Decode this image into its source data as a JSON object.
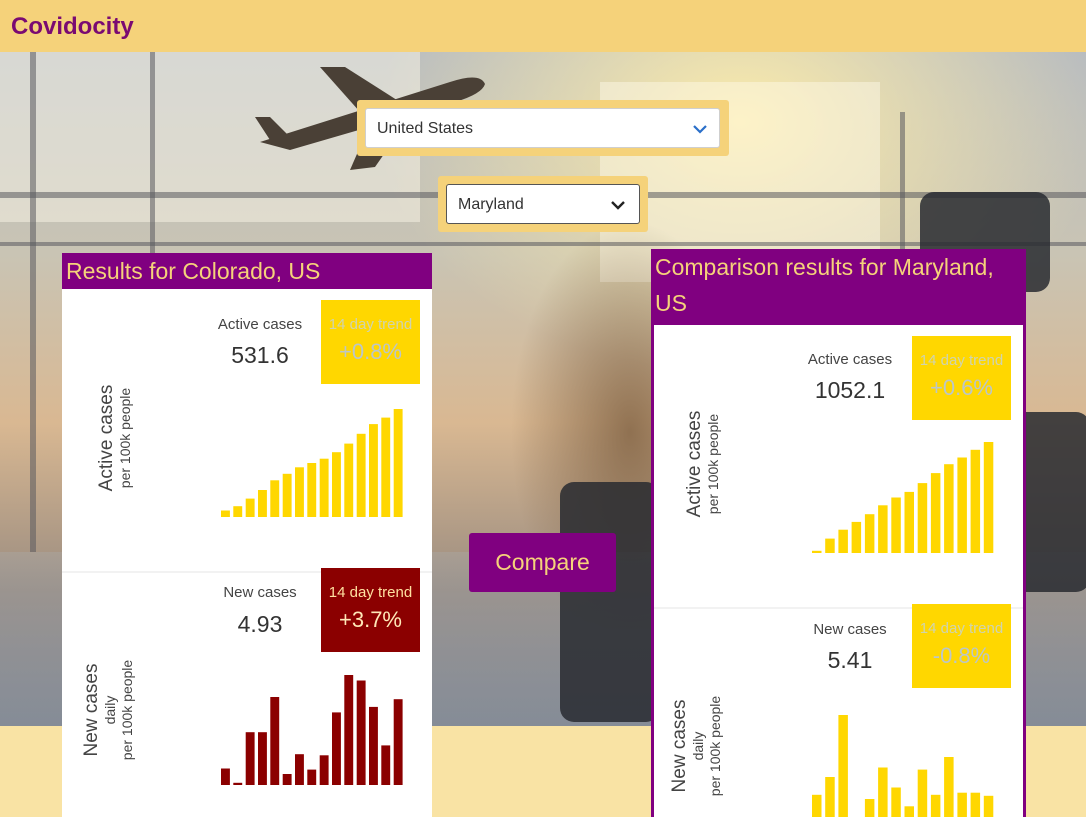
{
  "app": {
    "brand": "Covidocity"
  },
  "selectors": {
    "country": {
      "value": "United States"
    },
    "state": {
      "value": "Maryland"
    }
  },
  "compare_label": "Compare",
  "colors": {
    "purple": "#800080",
    "gold": "#f5d27a",
    "bar_yellow": "#ffd700",
    "bar_red": "#8b0000"
  },
  "primary": {
    "title": "Results for Colorado, US",
    "active": {
      "axis_line1": "Active cases",
      "axis_line2": "per 100k people",
      "label": "Active cases",
      "value": "531.6",
      "trend_label": "14 day trend",
      "trend_value": "+0.8%",
      "bars": [
        6,
        10,
        17,
        25,
        34,
        40,
        46,
        50,
        54,
        60,
        68,
        77,
        86,
        92,
        100
      ]
    },
    "new": {
      "axis_line1": "New cases",
      "axis_line2": "daily",
      "axis_line3": "per 100k people",
      "label": "New cases",
      "value": "4.93",
      "trend_label": "14 day trend",
      "trend_value": "+3.7%",
      "bars": [
        15,
        2,
        48,
        48,
        80,
        10,
        28,
        14,
        27,
        66,
        100,
        95,
        71,
        36,
        78
      ]
    }
  },
  "comparison": {
    "title": "Comparison results for Maryland, US",
    "active": {
      "axis_line1": "Active cases",
      "axis_line2": "per 100k people",
      "label": "Active cases",
      "value": "1052.1",
      "trend_label": "14 day trend",
      "trend_value": "+0.6%",
      "bars": [
        2,
        13,
        21,
        28,
        35,
        43,
        50,
        55,
        63,
        72,
        80,
        86,
        93,
        100
      ]
    },
    "new": {
      "axis_line1": "New cases",
      "axis_line2": "daily",
      "axis_line3": "per 100k people",
      "label": "New cases",
      "value": "5.41",
      "trend_label": "14 day trend",
      "trend_value": "-0.8%",
      "bars": [
        24,
        41,
        100,
        2,
        20,
        50,
        31,
        13,
        48,
        24,
        60,
        26,
        26,
        23
      ]
    }
  }
}
